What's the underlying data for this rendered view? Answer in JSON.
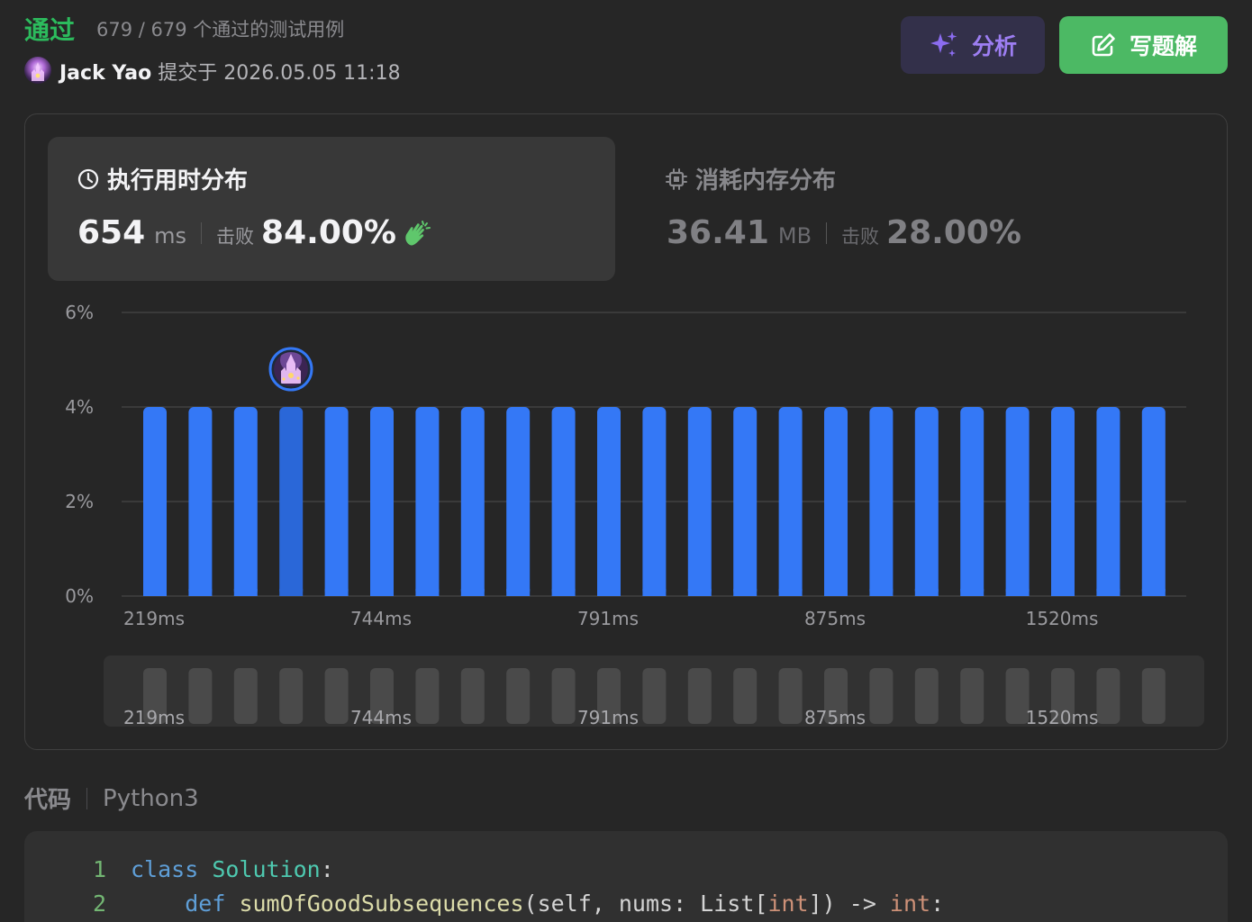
{
  "header": {
    "status": "通过",
    "cases_text": "679 / 679 个通过的测试用例",
    "author": "Jack Yao",
    "submitted_text": "提交于 2026.05.05 11:18",
    "analyze_label": "分析",
    "solution_label": "写题解"
  },
  "runtime": {
    "title": "执行用时分布",
    "value": "654",
    "unit": "ms",
    "beat_label": "击败",
    "beat_value": "84.00%",
    "icon": "clap-icon"
  },
  "memory": {
    "title": "消耗内存分布",
    "value": "36.41",
    "unit": "MB",
    "beat_label": "击败",
    "beat_value": "28.00%"
  },
  "chart_data": {
    "type": "bar",
    "y_ticks": [
      "0%",
      "2%",
      "4%",
      "6%"
    ],
    "ylim": [
      0,
      6
    ],
    "x_tick_labels": [
      "219ms",
      "744ms",
      "791ms",
      "875ms",
      "1520ms"
    ],
    "values": [
      4,
      4,
      4,
      4,
      4,
      4,
      4,
      4,
      4,
      4,
      4,
      4,
      4,
      4,
      4,
      4,
      4,
      4,
      4,
      4,
      4,
      4,
      4
    ],
    "highlight_index": 3,
    "grid": true,
    "colors": {
      "bar": "#3478f6",
      "bar_highlight": "#2a67d8",
      "navigator_bar": "#4a4a4a"
    }
  },
  "code": {
    "label": "代码",
    "language": "Python3",
    "lines": [
      {
        "number": "1",
        "tokens": [
          {
            "text": "class",
            "kind": "kw"
          },
          {
            "text": " ",
            "kind": "plain"
          },
          {
            "text": "Solution",
            "kind": "cls"
          },
          {
            "text": ":",
            "kind": "plain"
          }
        ]
      },
      {
        "number": "2",
        "tokens": [
          {
            "text": "    ",
            "kind": "plain"
          },
          {
            "text": "def",
            "kind": "kw"
          },
          {
            "text": " ",
            "kind": "plain"
          },
          {
            "text": "sumOfGoodSubsequences",
            "kind": "fn"
          },
          {
            "text": "(self, nums: List[",
            "kind": "plain"
          },
          {
            "text": "int",
            "kind": "typ"
          },
          {
            "text": "]) -> ",
            "kind": "plain"
          },
          {
            "text": "int",
            "kind": "typ"
          },
          {
            "text": ":",
            "kind": "plain"
          }
        ]
      }
    ]
  },
  "colors": {
    "accepted": "#2cbb5d",
    "solution_button": "#4cb964",
    "analyze_button_text": "#9d7ef2"
  }
}
